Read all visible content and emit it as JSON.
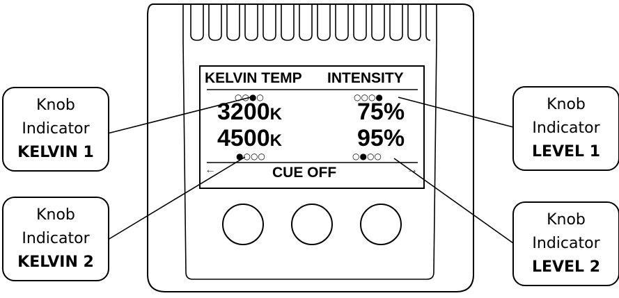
{
  "screen": {
    "header_left": "KELVIN TEMP",
    "header_right": "INTENSITY",
    "kelvin_1_value": "3200",
    "kelvin_1_unit": "K",
    "kelvin_2_value": "4500",
    "kelvin_2_unit": "K",
    "level_1_value": "75%",
    "level_2_value": "95%",
    "cue_label": "CUE OFF",
    "arrow_left": "←",
    "arrow_right": "→",
    "dots_kelvin_1": "○○●○",
    "dots_level_1": "○○○●",
    "dots_kelvin_2": "●○○○",
    "dots_level_2": "○●○○"
  },
  "callouts": {
    "kelvin_1": {
      "line1": "Knob",
      "line2": "Indicator",
      "line3": "KELVIN 1"
    },
    "kelvin_2": {
      "line1": "Knob",
      "line2": "Indicator",
      "line3": "KELVIN 2"
    },
    "level_1": {
      "line1": "Knob",
      "line2": "Indicator",
      "line3": "LEVEL 1"
    },
    "level_2": {
      "line1": "Knob",
      "line2": "Indicator",
      "line3": "LEVEL 2"
    }
  },
  "device": {
    "knob_count": 3
  }
}
